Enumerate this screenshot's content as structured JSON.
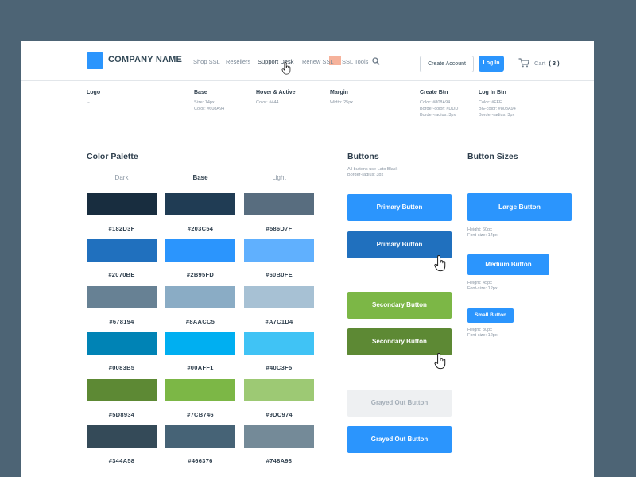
{
  "header": {
    "company_name": "COMPANY NAME",
    "nav": [
      "Shop SSL",
      "Resellers",
      "Support Desk",
      "Renew SSL",
      "SSL Tools"
    ],
    "create_account": "Create Account",
    "log_in": "Log In",
    "cart_label": "Cart",
    "cart_count": "( 3 )",
    "icons": [
      "search-icon",
      "cart-icon",
      "hand-cursor-icon"
    ],
    "highlight_color": "#f4a58a"
  },
  "specs": [
    {
      "title": "Logo",
      "lines": [
        "--"
      ]
    },
    {
      "title": "Base",
      "lines": [
        "Size: 14px",
        "Color: #608A94"
      ]
    },
    {
      "title": "Hover & Active",
      "lines": [
        "Color: #444"
      ]
    },
    {
      "title": "Margin",
      "lines": [
        "Width: 25px"
      ]
    },
    {
      "title": "Create Btn",
      "lines": [
        "Color: #808A94",
        "Border-color: #DDD",
        "Border-radius: 3px"
      ]
    },
    {
      "title": "Log In Btn",
      "lines": [
        "Color: #FFF",
        "BG-color: #808A94",
        "Border-radius: 3px"
      ]
    }
  ],
  "palette": {
    "title": "Color Palette",
    "columns": [
      "Dark",
      "Base",
      "Light"
    ],
    "rows": [
      [
        "#182D3F",
        "#203C54",
        "#586D7F"
      ],
      [
        "#2070BE",
        "#2B95FD",
        "#60B0FE"
      ],
      [
        "#678194",
        "#8AACC5",
        "#A7C1D4"
      ],
      [
        "#0083B5",
        "#00AFF1",
        "#40C3F5"
      ],
      [
        "#5D8934",
        "#7CB746",
        "#9DC974"
      ],
      [
        "#344A58",
        "#466376",
        "#748A98"
      ]
    ]
  },
  "buttons": {
    "title": "Buttons",
    "note": [
      "All buttons use Lato Black",
      "Border-radius: 3px"
    ],
    "primary": "Primary Button",
    "primary_hover": "Primary Button",
    "secondary": "Secondary Button",
    "secondary_hover": "Secondary Button",
    "grayed": "Grayed Out Button",
    "grayed_blue": "Grayed Out Button"
  },
  "sizes": {
    "title": "Button Sizes",
    "large": "Large Button",
    "large_note": [
      "Height: 60px",
      "Font-size: 14px"
    ],
    "medium": "Medium Button",
    "medium_note": [
      "Height: 45px",
      "Font-size: 12px"
    ],
    "small": "Small Button",
    "small_note": [
      "Height: 30px",
      "Font-size: 12px"
    ]
  }
}
